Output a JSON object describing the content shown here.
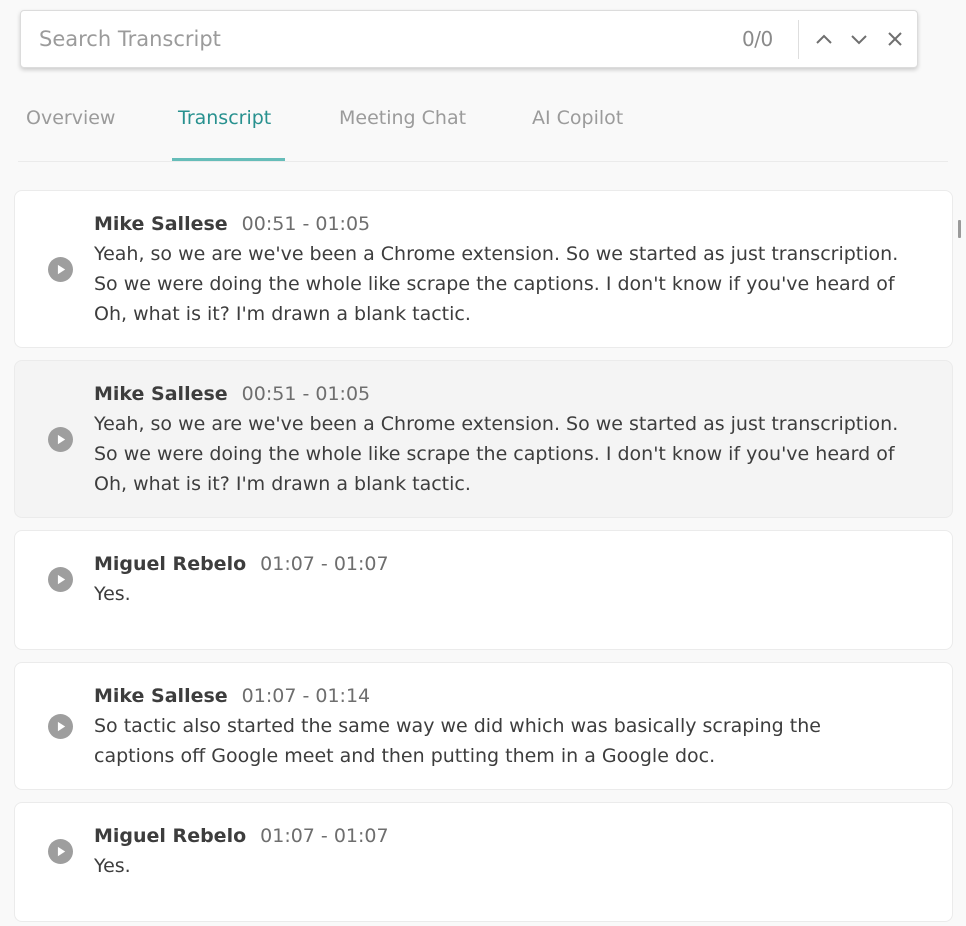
{
  "search": {
    "placeholder": "Search Transcript",
    "value": "",
    "count": "0/0",
    "prev_icon": "chevron-up-icon",
    "next_icon": "chevron-down-icon",
    "close_icon": "close-icon"
  },
  "tabs": [
    {
      "label": "Overview",
      "active": false
    },
    {
      "label": "Transcript",
      "active": true
    },
    {
      "label": "Meeting Chat",
      "active": false
    },
    {
      "label": "AI Copilot",
      "active": false
    }
  ],
  "colors": {
    "accent": "#28918f",
    "tab_underline": "#66bdb9",
    "highlight_card": "#f4f4f4",
    "play_icon": "#9e9e9e"
  },
  "transcript": [
    {
      "speaker": "Mike Sallese",
      "time": "00:51 - 01:05",
      "lines": [
        "Yeah, so we are we've been a Chrome extension. So we started as just transcription.",
        "So we were doing the whole like scrape the captions. I don't know if you've heard of",
        "Oh, what is it? I'm drawn a blank tactic."
      ],
      "highlighted": false
    },
    {
      "speaker": "Mike Sallese",
      "time": "00:51 - 01:05",
      "lines": [
        "Yeah, so we are we've been a Chrome extension. So we started as just transcription.",
        "So we were doing the whole like scrape the captions. I don't know if you've heard of",
        "Oh, what is it? I'm drawn a blank tactic."
      ],
      "highlighted": true
    },
    {
      "speaker": "Miguel Rebelo",
      "time": "01:07 - 01:07",
      "lines": [
        "Yes."
      ],
      "highlighted": false
    },
    {
      "speaker": "Mike Sallese",
      "time": "01:07 - 01:14",
      "lines": [
        "So tactic also started the same way we did which was basically scraping the",
        "captions off Google meet and then putting them in a Google doc."
      ],
      "highlighted": false
    },
    {
      "speaker": "Miguel Rebelo",
      "time": "01:07 - 01:07",
      "lines": [
        "Yes."
      ],
      "highlighted": false
    }
  ]
}
